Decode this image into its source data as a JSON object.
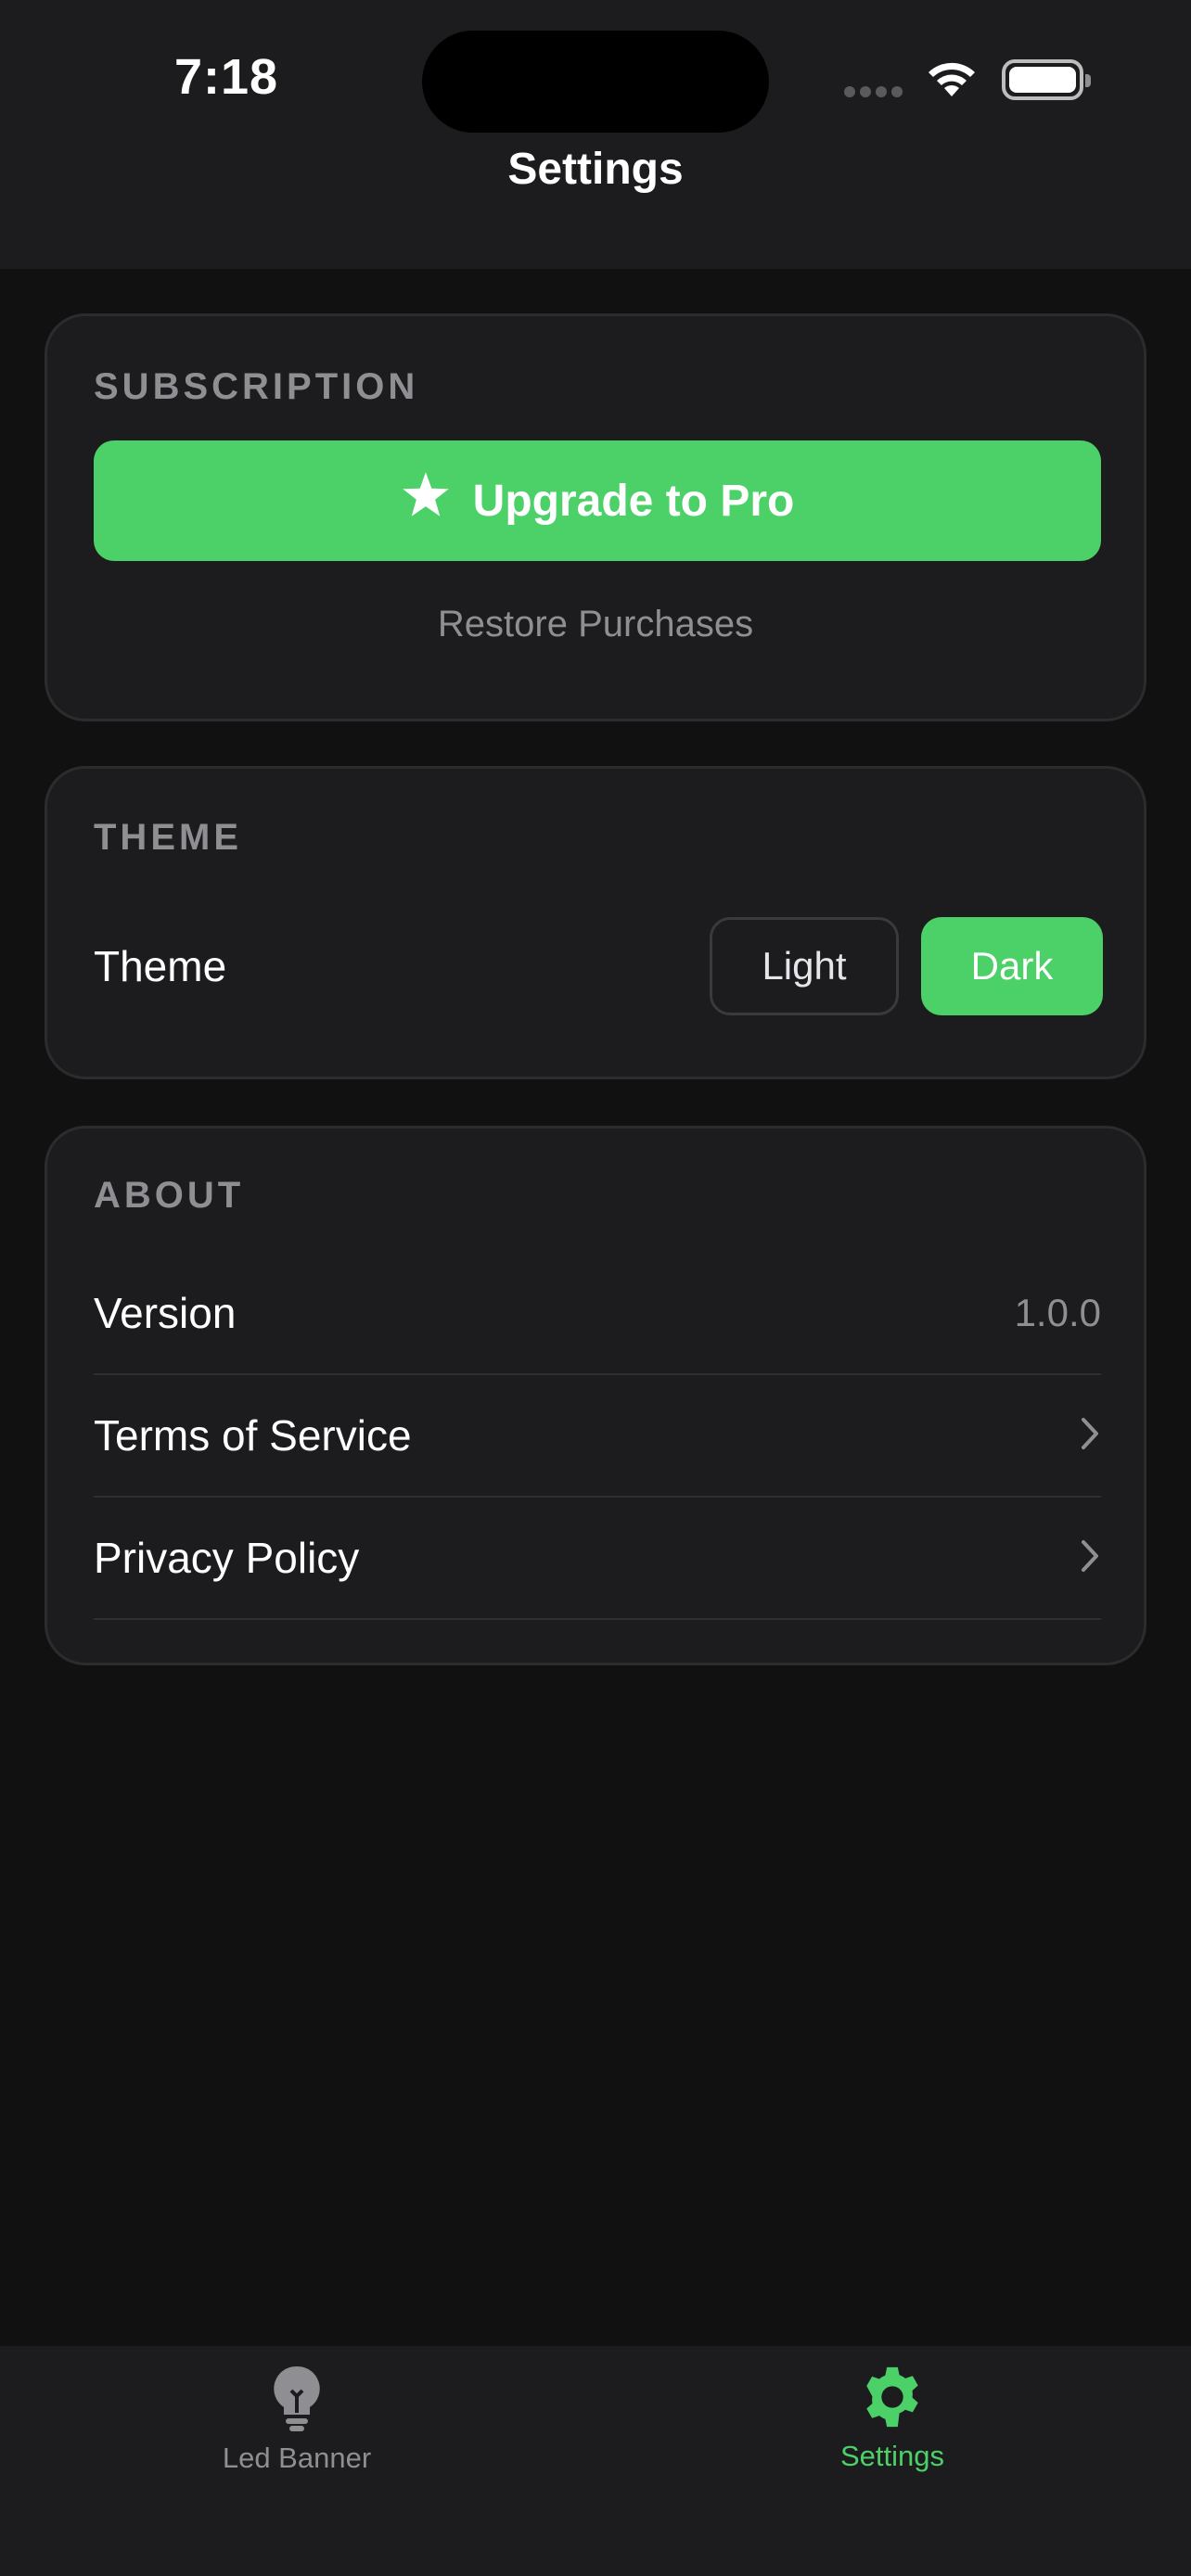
{
  "status": {
    "time": "7:18"
  },
  "nav": {
    "title": "Settings"
  },
  "subscription": {
    "section_label": "SUBSCRIPTION",
    "upgrade_label": "Upgrade to Pro",
    "restore_label": "Restore Purchases"
  },
  "theme": {
    "section_label": "THEME",
    "row_label": "Theme",
    "options": [
      "Light",
      "Dark"
    ],
    "selected": "Dark"
  },
  "about": {
    "section_label": "ABOUT",
    "rows": [
      {
        "label": "Version",
        "value": "1.0.0"
      },
      {
        "label": "Terms of Service"
      },
      {
        "label": "Privacy Policy"
      }
    ]
  },
  "tabs": [
    {
      "label": "Led Banner",
      "icon": "lightbulb-icon",
      "active": false
    },
    {
      "label": "Settings",
      "icon": "gear-icon",
      "active": true
    }
  ],
  "colors": {
    "accent": "#4cd068",
    "background": "#111111",
    "card": "#1c1c1e",
    "muted": "#8e8e93"
  }
}
